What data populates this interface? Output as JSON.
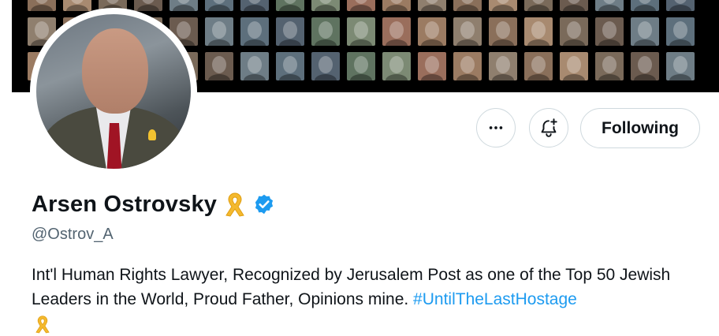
{
  "profile": {
    "name": "Arsen Ostrovsky",
    "handle": "@Ostrov_A",
    "bio_text": "Int'l Human Rights Lawyer, Recognized by Jerusalem Post as one of the Top 50 Jewish Leaders in the World, Proud Father, Opinions mine.",
    "bio_hashtag": "#UntilTheLastHostage",
    "verified_icon": "verified-badge-icon",
    "name_emoji_icon": "yellow-ribbon-icon"
  },
  "actions": {
    "more_icon": "more-horizontal-icon",
    "notify_icon": "bell-plus-icon",
    "follow_label": "Following"
  },
  "colors": {
    "link": "#1d9bf0",
    "verified": "#1d9bf0",
    "ribbon": "#f4b92e",
    "banner_bg": "#000000",
    "border": "#cfd9de"
  }
}
